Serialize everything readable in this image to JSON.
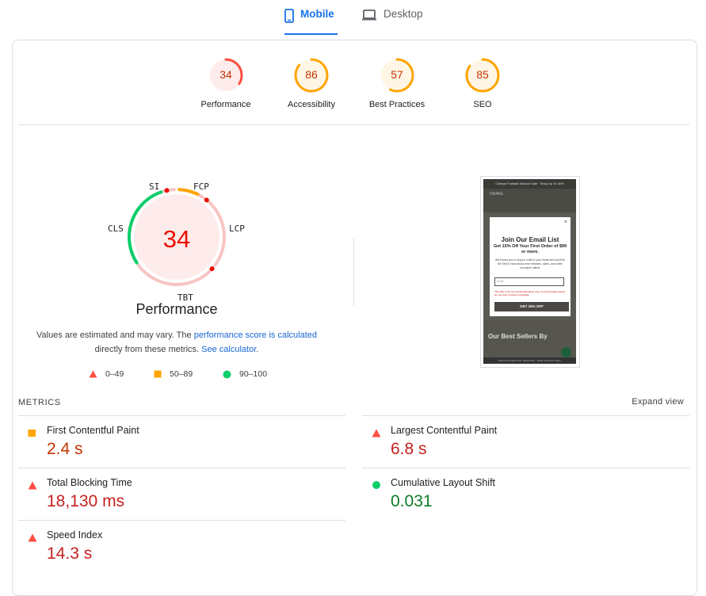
{
  "tabs": [
    {
      "label": "Mobile",
      "active": true
    },
    {
      "label": "Desktop",
      "active": false
    }
  ],
  "scores": [
    {
      "value": "34",
      "label": "Performance",
      "fraction": 0.34,
      "color": "#ff4e42",
      "bg": "#fdeceb",
      "text_color": "#c33300"
    },
    {
      "value": "86",
      "label": "Accessibility",
      "fraction": 0.86,
      "color": "#ffa400",
      "bg": "#fff6e6",
      "text_color": "#c33300"
    },
    {
      "value": "57",
      "label": "Best Practices",
      "fraction": 0.57,
      "color": "#ffa400",
      "bg": "#fff6e6",
      "text_color": "#c33300"
    },
    {
      "value": "85",
      "label": "SEO",
      "fraction": 0.85,
      "color": "#ffa400",
      "bg": "#fff6e6",
      "text_color": "#c33300"
    }
  ],
  "performance": {
    "score": "34",
    "title": "Performance",
    "metric_tags": {
      "si": "SI",
      "fcp": "FCP",
      "lcp": "LCP",
      "tbt": "TBT",
      "cls": "CLS"
    },
    "note_text_1": "Values are estimated and may vary. The ",
    "note_link_1": "performance score is calculated",
    "note_text_2": " directly from these metrics. ",
    "note_link_2": "See calculator",
    "note_text_3": "."
  },
  "legend": [
    {
      "range": "0–49",
      "shape": "triangle",
      "color": "#ff4e42"
    },
    {
      "range": "50–89",
      "shape": "square",
      "color": "#ffa400"
    },
    {
      "range": "90–100",
      "shape": "circle",
      "color": "#0cce6b"
    }
  ],
  "screenshot": {
    "top_bar": "College Football Season Sale · Shop Up To 40%",
    "logo": "DRAKE",
    "modal_title": "Join Our Email List",
    "modal_sub": "Get 15% Off Your First Order of $99 or more.",
    "modal_body": "We'll send you a coupon code to your email and you'll be the first to hear about new releases, sales, and other exclusive offers!",
    "modal_input_placeholder": "Email",
    "modal_warning": "This offer is for new email subscribers only. If you're already signed up, you won't receive a message.",
    "modal_button": "GET 15% OFF",
    "best_title": "Our Best Sellers By",
    "footer": "DRAKE WATERFOWL REWARDS · FREE SHIPPING $99+"
  },
  "metrics": {
    "heading": "METRICS",
    "expand_label": "Expand view",
    "items": [
      {
        "name": "First Contentful Paint",
        "value": "2.4 s",
        "status": "average"
      },
      {
        "name": "Largest Contentful Paint",
        "value": "6.8 s",
        "status": "fail"
      },
      {
        "name": "Total Blocking Time",
        "value": "18,130 ms",
        "status": "fail"
      },
      {
        "name": "Cumulative Layout Shift",
        "value": "0.031",
        "status": "pass"
      },
      {
        "name": "Speed Index",
        "value": "14.3 s",
        "status": "fail"
      }
    ]
  }
}
